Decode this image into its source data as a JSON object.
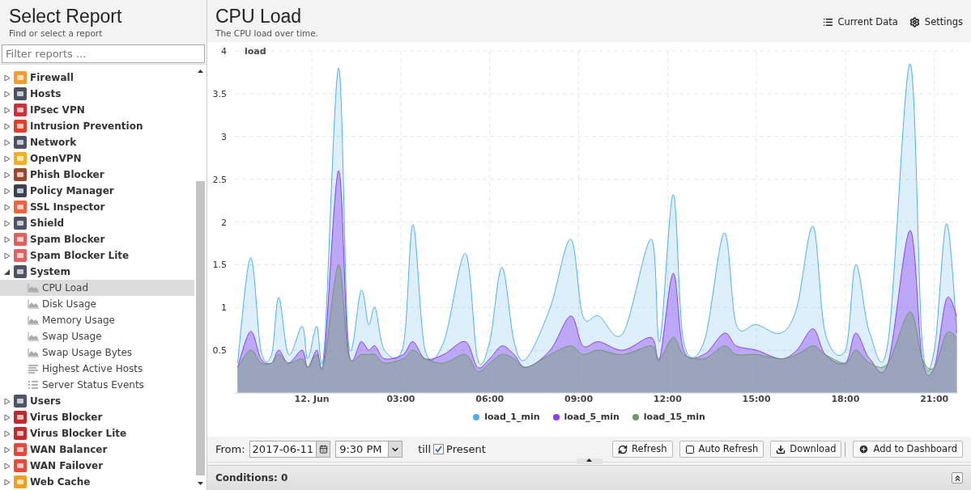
{
  "sidebar": {
    "title": "Select Report",
    "subtitle": "Find or select a report",
    "filter": {
      "placeholder": "Filter reports ..."
    },
    "tree": [
      {
        "label": "Firewall",
        "color": "#f39c2c",
        "expanded": false
      },
      {
        "label": "Hosts",
        "color": "#4a5160",
        "expanded": false
      },
      {
        "label": "IPsec VPN",
        "color": "#d0303a",
        "expanded": false
      },
      {
        "label": "Intrusion Prevention",
        "color": "#e0402a",
        "expanded": false
      },
      {
        "label": "Network",
        "color": "#4b5262",
        "expanded": false
      },
      {
        "label": "OpenVPN",
        "color": "#f0b020",
        "expanded": false
      },
      {
        "label": "Phish Blocker",
        "color": "#9a4a2a",
        "expanded": false
      },
      {
        "label": "Policy Manager",
        "color": "#3b4150",
        "expanded": false
      },
      {
        "label": "SSL Inspector",
        "color": "#f06040",
        "expanded": false
      },
      {
        "label": "Shield",
        "color": "#4c5364",
        "expanded": false
      },
      {
        "label": "Spam Blocker",
        "color": "#e06060",
        "expanded": false
      },
      {
        "label": "Spam Blocker Lite",
        "color": "#e06262",
        "expanded": false
      },
      {
        "label": "System",
        "color": "#4d5465",
        "expanded": true,
        "children": [
          {
            "label": "CPU Load",
            "kind": "area-chart",
            "selected": true
          },
          {
            "label": "Disk Usage",
            "kind": "area-chart",
            "selected": false
          },
          {
            "label": "Memory Usage",
            "kind": "area-chart",
            "selected": false
          },
          {
            "label": "Swap Usage",
            "kind": "area-chart",
            "selected": false
          },
          {
            "label": "Swap Usage Bytes",
            "kind": "area-chart",
            "selected": false
          },
          {
            "label": "Highest Active Hosts",
            "kind": "text-chart",
            "selected": false
          },
          {
            "label": "Server Status Events",
            "kind": "event-list",
            "selected": false
          }
        ]
      },
      {
        "label": "Users",
        "color": "#4e5566",
        "expanded": false
      },
      {
        "label": "Virus Blocker",
        "color": "#c0282a",
        "expanded": false
      },
      {
        "label": "Virus Blocker Lite",
        "color": "#c2292b",
        "expanded": false
      },
      {
        "label": "WAN Balancer",
        "color": "#e8483a",
        "expanded": false
      },
      {
        "label": "WAN Failover",
        "color": "#e9493b",
        "expanded": false
      },
      {
        "label": "Web Cache",
        "color": "#f0a020",
        "expanded": false
      }
    ]
  },
  "report": {
    "title": "CPU Load",
    "description": "The CPU load over time.",
    "actions": [
      {
        "label": "Current Data",
        "kind": "list"
      },
      {
        "label": "Settings",
        "kind": "gear"
      }
    ],
    "chart_data": {
      "type": "area",
      "ylabel": "load",
      "xlim": [
        -2.6,
        21.8
      ],
      "ylim": [
        0,
        4
      ],
      "grid": true,
      "legend": true,
      "x": [
        -2.51,
        -2.07,
        -1.72,
        -1.36,
        -1.12,
        -0.79,
        -0.33,
        -0.14,
        0.16,
        0.41,
        0.9,
        1.23,
        1.66,
        1.91,
        2.13,
        2.45,
        3.08,
        3.41,
        3.82,
        4.45,
        5.18,
        5.59,
        6.0,
        6.41,
        6.82,
        7.23,
        8.04,
        8.73,
        9.14,
        9.68,
        10.5,
        11.45,
        11.73,
        12.19,
        12.54,
        13.23,
        13.91,
        14.32,
        15.0,
        15.82,
        16.36,
        16.91,
        17.32,
        18.0,
        18.35,
        18.82,
        19.44,
        20.18,
        20.59,
        21.0,
        21.41,
        21.76
      ],
      "series": [
        {
          "name": "load_1_min",
          "color": "#4fb0ec",
          "values": [
            0.35,
            1.58,
            0.5,
            0.45,
            1.12,
            0.45,
            0.78,
            0.4,
            0.78,
            0.5,
            3.8,
            0.6,
            1.2,
            0.8,
            1.0,
            0.5,
            0.55,
            1.97,
            0.5,
            0.6,
            1.63,
            0.4,
            0.6,
            1.47,
            0.6,
            0.4,
            1.0,
            1.8,
            0.9,
            0.9,
            0.7,
            1.8,
            0.6,
            2.32,
            0.6,
            0.6,
            1.87,
            0.8,
            0.8,
            0.7,
            1.0,
            1.95,
            0.7,
            0.5,
            1.5,
            0.7,
            0.6,
            3.85,
            0.6,
            0.5,
            1.98,
            0.7
          ]
        },
        {
          "name": "load_5_min",
          "color": "#8d3ef0",
          "values": [
            0.3,
            0.72,
            0.4,
            0.35,
            0.5,
            0.35,
            0.5,
            0.3,
            0.5,
            0.4,
            2.6,
            0.5,
            0.6,
            0.5,
            0.55,
            0.4,
            0.45,
            0.6,
            0.4,
            0.45,
            0.6,
            0.3,
            0.4,
            0.55,
            0.45,
            0.3,
            0.5,
            0.9,
            0.55,
            0.6,
            0.5,
            0.65,
            0.4,
            1.4,
            0.5,
            0.45,
            0.7,
            0.55,
            0.5,
            0.4,
            0.5,
            0.75,
            0.45,
            0.35,
            0.7,
            0.4,
            0.35,
            1.9,
            0.4,
            0.3,
            1.1,
            0.9
          ]
        },
        {
          "name": "load_15_min",
          "color": "#6a9a6a",
          "values": [
            0.3,
            0.5,
            0.35,
            0.35,
            0.45,
            0.35,
            0.4,
            0.3,
            0.45,
            0.35,
            1.5,
            0.45,
            0.45,
            0.45,
            0.45,
            0.35,
            0.4,
            0.5,
            0.4,
            0.35,
            0.45,
            0.25,
            0.35,
            0.45,
            0.4,
            0.3,
            0.45,
            0.55,
            0.45,
            0.5,
            0.45,
            0.55,
            0.4,
            0.65,
            0.45,
            0.4,
            0.55,
            0.45,
            0.45,
            0.4,
            0.45,
            0.55,
            0.45,
            0.35,
            0.5,
            0.35,
            0.35,
            0.95,
            0.4,
            0.3,
            0.7,
            0.65
          ]
        }
      ],
      "xticks": [
        {
          "value": 0,
          "label": "12. Jun"
        },
        {
          "value": 3,
          "label": "03:00"
        },
        {
          "value": 6,
          "label": "06:00"
        },
        {
          "value": 9,
          "label": "09:00"
        },
        {
          "value": 12,
          "label": "12:00"
        },
        {
          "value": 15,
          "label": "15:00"
        },
        {
          "value": 18,
          "label": "18:00"
        },
        {
          "value": 21,
          "label": "21:00"
        }
      ],
      "yticks": [
        0.5,
        1,
        1.5,
        2,
        2.5,
        3,
        3.5,
        4
      ]
    },
    "toolbar": {
      "from_label": "From:",
      "date": "2017-06-11",
      "time": "9:30 PM",
      "till_label": "till",
      "present": {
        "label": "Present",
        "checked": true
      },
      "buttons": [
        {
          "label": "Refresh",
          "kind": "refresh"
        },
        {
          "label": "Auto Refresh",
          "kind": "toggle",
          "checked": false
        },
        {
          "label": "Download",
          "kind": "download"
        },
        {
          "label": "Add to Dashboard",
          "kind": "add"
        }
      ]
    },
    "conditions": "Conditions: 0"
  }
}
